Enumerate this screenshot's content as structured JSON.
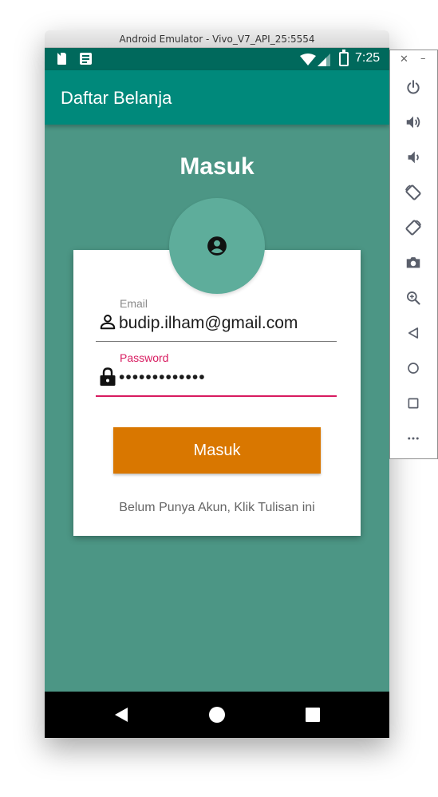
{
  "window": {
    "title": "Android Emulator - Vivo_V7_API_25:5554"
  },
  "statusbar": {
    "time": "7:25",
    "icons": [
      "sd-card-icon",
      "notes-icon",
      "wifi-icon",
      "signal-icon",
      "battery-icon"
    ]
  },
  "appbar": {
    "title": "Daftar Belanja"
  },
  "login": {
    "heading": "Masuk",
    "avatar_icon": "account-circle-icon",
    "email": {
      "label": "Email",
      "value": "budip.ilham@gmail.com",
      "icon": "person-icon"
    },
    "password": {
      "label": "Password",
      "value": "•••••••••••••",
      "icon": "lock-icon"
    },
    "submit_label": "Masuk",
    "register_link": "Belum Punya Akun, Klik Tulisan ini"
  },
  "navbar": {
    "buttons": [
      "back-icon",
      "home-icon",
      "recents-icon"
    ]
  },
  "emulator_toolbar": {
    "buttons": [
      "close-icon",
      "minimize-icon",
      "power-icon",
      "volume-up-icon",
      "volume-down-icon",
      "rotate-left-icon",
      "rotate-right-icon",
      "camera-icon",
      "zoom-icon",
      "back-icon",
      "home-icon",
      "overview-icon",
      "more-icon"
    ]
  },
  "colors": {
    "status_bar": "#00695c",
    "app_bar": "#00897b",
    "background": "#4c9685",
    "avatar": "#5ead9b",
    "button": "#d97700",
    "accent": "#d81b60",
    "toolbar_icon": "#5a5f6b"
  }
}
